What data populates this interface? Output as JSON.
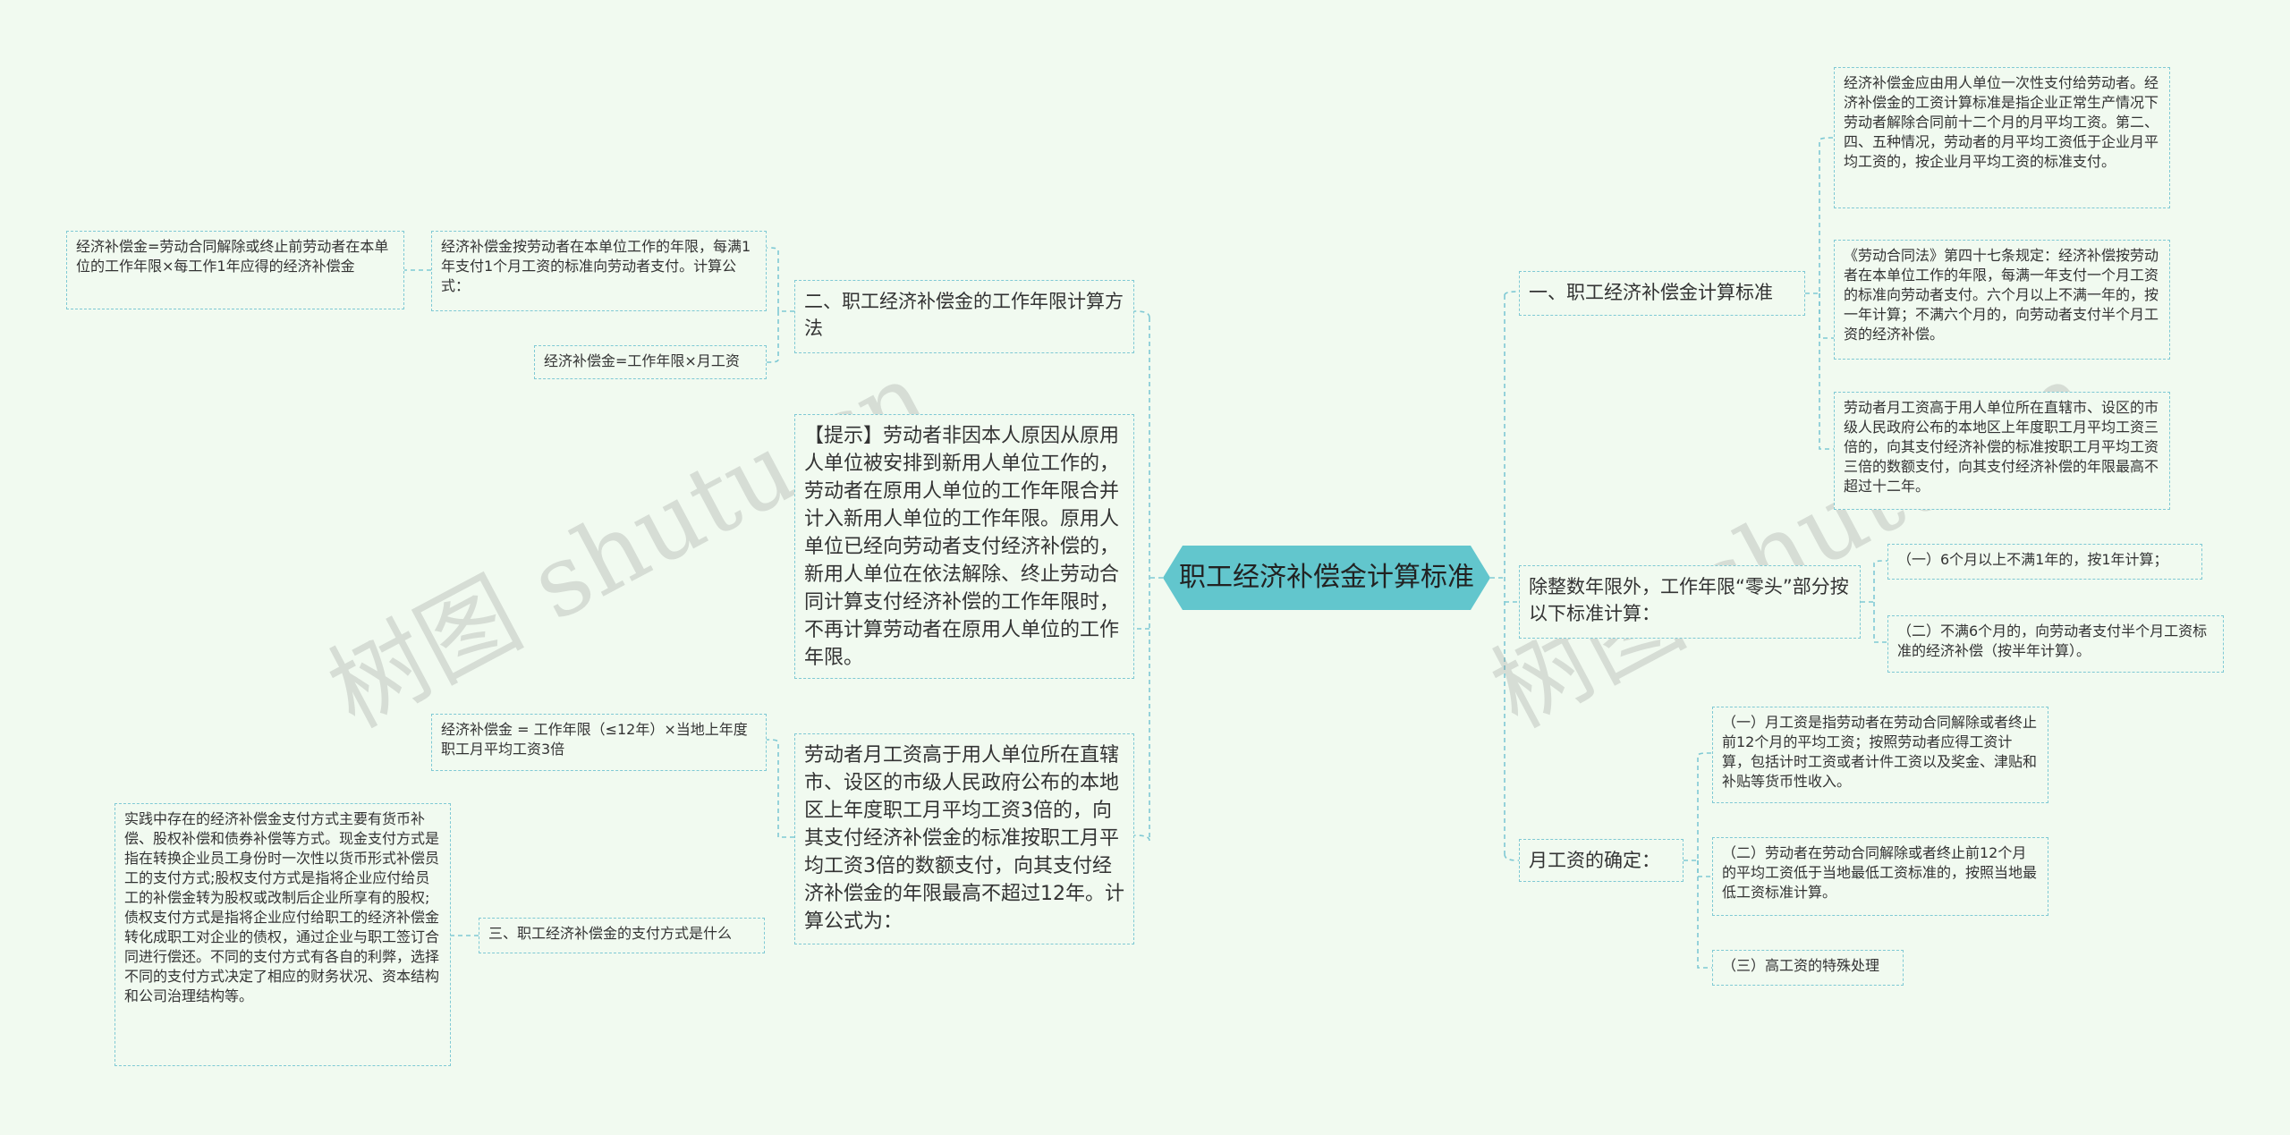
{
  "center": "职工经济补偿金计算标准",
  "watermark": "树图 shutu.cn",
  "left": {
    "b2": {
      "title": "二、职工经济补偿金的工作年限计算方法",
      "c1": "经济补偿金按劳动者在本单位工作的年限，每满1年支付1个月工资的标准向劳动者支付。计算公式：",
      "c1_child": "经济补偿金=劳动合同解除或终止前劳动者在本单位的工作年限×每工作1年应得的经济补偿金",
      "c2": "经济补偿金=工作年限×月工资"
    },
    "tip": "【提示】劳动者非因本人原因从原用人单位被安排到新用人单位工作的，劳动者在原用人单位的工作年限合并计入新用人单位的工作年限。原用人单位已经向劳动者支付经济补偿的，新用人单位在依法解除、终止劳动合同计算支付经济补偿的工作年限时，不再计算劳动者在原用人单位的工作年限。",
    "high": {
      "text": "劳动者月工资高于用人单位所在直辖市、设区的市级人民政府公布的本地区上年度职工月平均工资3倍的，向其支付经济补偿金的标准按职工月平均工资3倍的数额支付，向其支付经济补偿金的年限最高不超过12年。计算公式为：",
      "formula": "经济补偿金 = 工作年限（≤12年）×当地上年度职工月平均工资3倍"
    },
    "b3": {
      "title": "三、职工经济补偿金的支付方式是什么",
      "detail": "实践中存在的经济补偿金支付方式主要有货币补偿、股权补偿和债券补偿等方式。现金支付方式是指在转换企业员工身份时一次性以货币形式补偿员工的支付方式;股权支付方式是指将企业应付给员工的补偿金转为股权或改制后企业所享有的股权;债权支付方式是指将企业应付给职工的经济补偿金转化成职工对企业的债权，通过企业与职工签订合同进行偿还。不同的支付方式有各自的利弊，选择不同的支付方式决定了相应的财务状况、资本结构和公司治理结构等。"
    }
  },
  "right": {
    "b1": {
      "title": "一、职工经济补偿金计算标准",
      "c1": "经济补偿金应由用人单位一次性支付给劳动者。经济补偿金的工资计算标准是指企业正常生产情况下劳动者解除合同前十二个月的月平均工资。第二、四、五种情况，劳动者的月平均工资低于企业月平均工资的，按企业月平均工资的标准支付。",
      "c2": "《劳动合同法》第四十七条规定：经济补偿按劳动者在本单位工作的年限，每满一年支付一个月工资的标准向劳动者支付。六个月以上不满一年的，按一年计算；不满六个月的，向劳动者支付半个月工资的经济补偿。",
      "c3": "劳动者月工资高于用人单位所在直辖市、设区的市级人民政府公布的本地区上年度职工月平均工资三倍的，向其支付经济补偿的标准按职工月平均工资三倍的数额支付，向其支付经济补偿的年限最高不超过十二年。"
    },
    "b2": {
      "title": "除整数年限外，工作年限“零头”部分按以下标准计算：",
      "c1": "（一）6个月以上不满1年的，按1年计算；",
      "c2": "（二）不满6个月的，向劳动者支付半个月工资标准的经济补偿（按半年计算）。"
    },
    "b3": {
      "title": "月工资的确定：",
      "c1": "（一）月工资是指劳动者在劳动合同解除或者终止前12个月的平均工资；按照劳动者应得工资计算，包括计时工资或者计件工资以及奖金、津贴和补贴等货币性收入。",
      "c2": "（二）劳动者在劳动合同解除或者终止前12个月的平均工资低于当地最低工资标准的，按照当地最低工资标准计算。",
      "c3": "（三）高工资的特殊处理"
    }
  },
  "colors": {
    "center": "#62c6cd",
    "line": "#7fc9d4",
    "background": "#f1faf0"
  }
}
